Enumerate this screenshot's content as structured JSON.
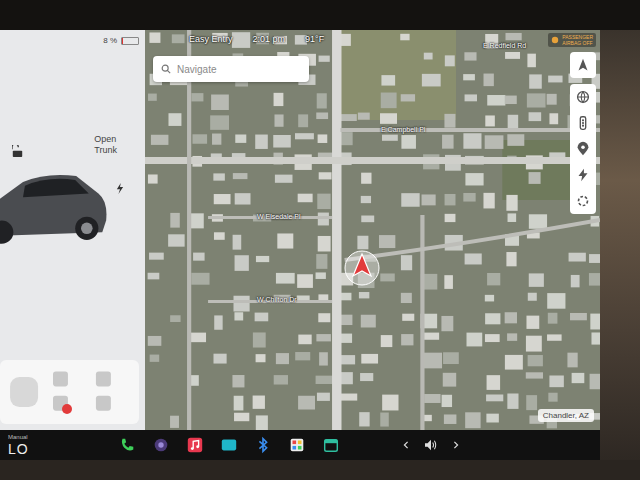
{
  "status_bar": {
    "battery": "8 %",
    "battery_level": 0.08,
    "driver_profile": "Easy Entry",
    "time": "2:01 pm",
    "temperature": "91°F",
    "airbag_status": [
      "PASSENGER",
      "AIRBAG OFF"
    ]
  },
  "car_panel": {
    "trunk_action": [
      "Open",
      "Trunk"
    ],
    "locked": false
  },
  "search": {
    "placeholder": "Navigate"
  },
  "map": {
    "location": "Chandler, AZ",
    "streets": [
      "E Redfield Rd",
      "E Campbell Pl",
      "W Elsedale Pl",
      "W Chilton Dr"
    ]
  },
  "climate": {
    "mode": "Manual",
    "temperature": "LO"
  },
  "seat_panel": {
    "seat_alert": true
  }
}
